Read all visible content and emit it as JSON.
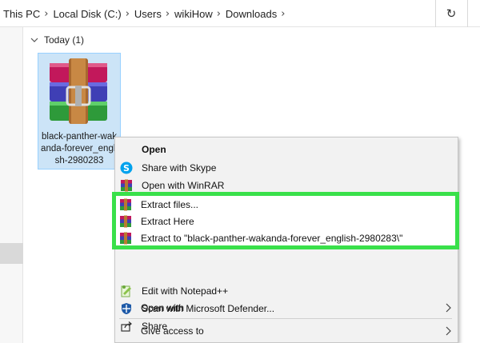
{
  "address_bar": {
    "crumbs": [
      "This PC",
      "Local Disk (C:)",
      "Users",
      "wikiHow",
      "Downloads"
    ],
    "refresh_icon": "refresh-icon"
  },
  "group": {
    "label": "Today (1)"
  },
  "file": {
    "name": "black-panther-wakanda-forever_english-2980283",
    "icon": "winrar-archive-icon"
  },
  "context_menu": {
    "items": [
      {
        "label": "Open",
        "icon": "none",
        "bold": true
      },
      {
        "label": "Share with Skype",
        "icon": "skype-icon"
      },
      {
        "label": "Open with WinRAR",
        "icon": "winrar-icon"
      },
      {
        "label": "Extract files...",
        "icon": "winrar-icon"
      },
      {
        "label": "Extract Here",
        "icon": "winrar-icon"
      },
      {
        "label": "Extract to \"black-panther-wakanda-forever_english-2980283\\\"",
        "icon": "winrar-icon"
      },
      {
        "label": "Edit with Notepad++",
        "icon": "notepad-plus-plus-icon"
      },
      {
        "label": "Scan with Microsoft Defender...",
        "icon": "defender-shield-icon"
      },
      {
        "label": "Share",
        "icon": "share-icon"
      },
      {
        "label": "Open with",
        "icon": "none",
        "submenu": true
      },
      {
        "label": "Give access to",
        "icon": "none",
        "submenu": true
      }
    ]
  },
  "highlight_color": "#39e04a"
}
